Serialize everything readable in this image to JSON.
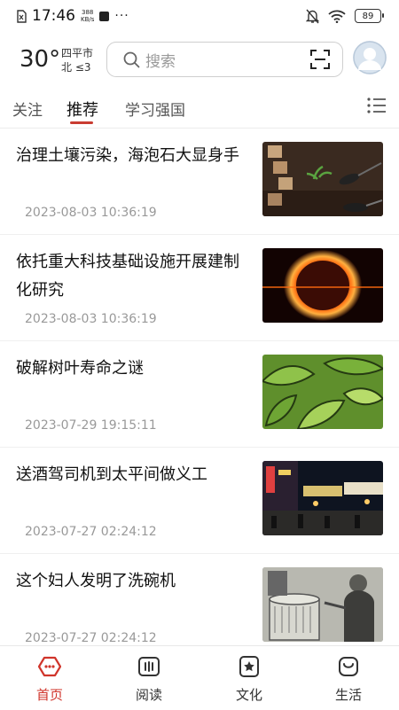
{
  "status_bar": {
    "time": "17:46",
    "net_speed_value": "388",
    "net_speed_unit": "KB/s",
    "more": "···",
    "battery": "89"
  },
  "header": {
    "temperature": "30°",
    "city": "四平市",
    "wind": "北 ≤3",
    "search_placeholder": "搜索"
  },
  "tabs": [
    "关注",
    "推荐",
    "学习强国"
  ],
  "active_tab": "推荐",
  "news": [
    {
      "title": "治理土壤污染，海泡石大显身手",
      "date": "2023-08-03 10:36:19",
      "thumb_icon": "soil-seedling-image"
    },
    {
      "title": "依托重大科技基础设施开展建制化研究",
      "date": "2023-08-03 10:36:19",
      "thumb_icon": "fiery-ring-image"
    },
    {
      "title": "破解树叶寿命之谜",
      "date": "2023-07-29 19:15:11",
      "thumb_icon": "green-leaves-image"
    },
    {
      "title": "送酒驾司机到太平间做义工",
      "date": "2023-07-27 02:24:12",
      "thumb_icon": "night-street-image"
    },
    {
      "title": "这个妇人发明了洗碗机",
      "date": "2023-07-27 02:24:12",
      "thumb_icon": "vintage-dishwasher-photo"
    }
  ],
  "bottom_nav": [
    {
      "label": "首页",
      "icon": "home-hexagon-icon"
    },
    {
      "label": "阅读",
      "icon": "book-icon"
    },
    {
      "label": "文化",
      "icon": "star-badge-icon"
    },
    {
      "label": "生活",
      "icon": "life-bag-icon"
    }
  ],
  "colors": {
    "accent": "#d0352b",
    "text": "#111111",
    "muted": "#999999"
  }
}
